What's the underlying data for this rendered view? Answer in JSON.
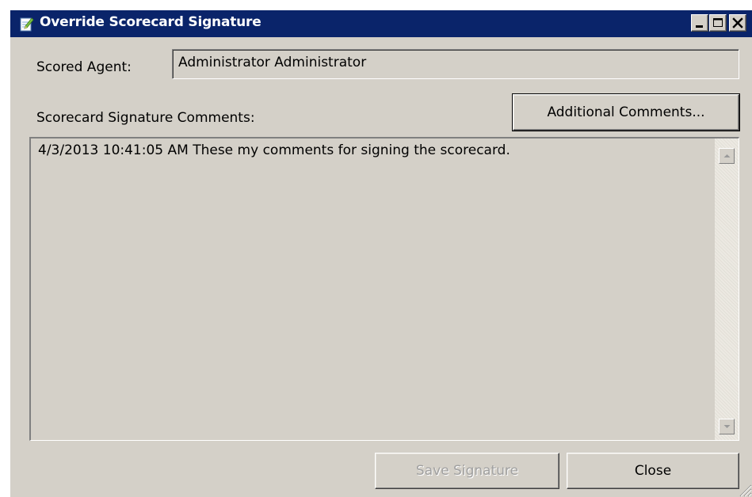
{
  "window": {
    "title": "Override Scorecard Signature",
    "title_icon": "notepad-icon",
    "controls": [
      "minimize-icon",
      "maximize-icon",
      "close-x-icon"
    ]
  },
  "scored_agent": {
    "label": "Scored Agent:",
    "value": "Administrator Administrator"
  },
  "comments": {
    "label": "Scorecard Signature Comments:",
    "additional_button": "Additional Comments...",
    "text": "4/3/2013 10:41:05 AM  These my comments for signing the scorecard."
  },
  "footer": {
    "save_label": "Save Signature",
    "save_enabled": false,
    "close_label": "Close"
  },
  "colors": {
    "titlebar": "#0a246a",
    "face": "#d4d0c8",
    "disabled_text": "#a0a0a0"
  }
}
